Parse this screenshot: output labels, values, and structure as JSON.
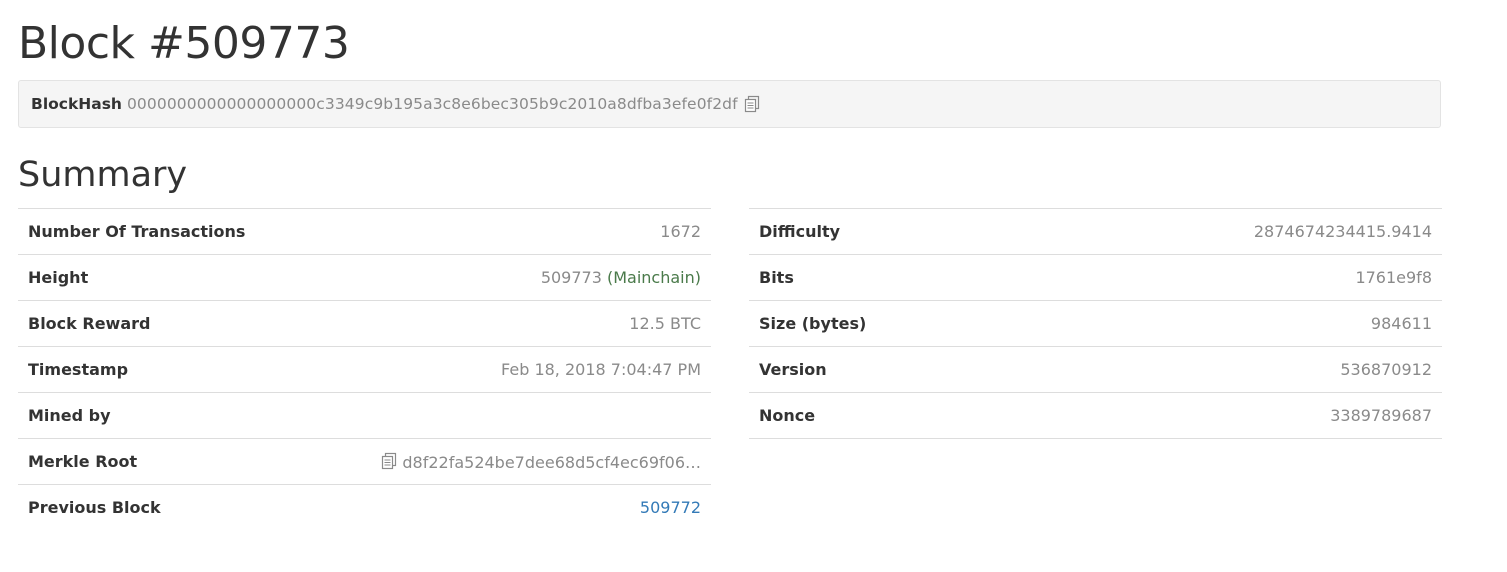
{
  "block": {
    "title": "Block #509773",
    "hash_label": "BlockHash",
    "hash_value": "0000000000000000000c3349c9b195a3c8e6bec305b9c2010a8dfba3efe0f2df"
  },
  "summary": {
    "title": "Summary",
    "left_rows": [
      {
        "label": "Number Of Transactions",
        "value": "1672"
      },
      {
        "label": "Height",
        "value": "509773",
        "chain": "(Mainchain)"
      },
      {
        "label": "Block Reward",
        "value": "12.5 BTC"
      },
      {
        "label": "Timestamp",
        "value": "Feb 18, 2018 7:04:47 PM"
      },
      {
        "label": "Mined by",
        "value": ""
      },
      {
        "label": "Merkle Root",
        "value": "d8f22fa524be7dee68d5cf4ec69f06…"
      },
      {
        "label": "Previous Block",
        "value": "509772"
      }
    ],
    "right_rows": [
      {
        "label": "Difficulty",
        "value": "2874674234415.9414"
      },
      {
        "label": "Bits",
        "value": "1761e9f8"
      },
      {
        "label": "Size (bytes)",
        "value": "984611"
      },
      {
        "label": "Version",
        "value": "536870912"
      },
      {
        "label": "Nonce",
        "value": "3389789687"
      }
    ]
  },
  "icons": {
    "copy": "copy-icon"
  },
  "colors": {
    "text": "#333333",
    "muted": "#8a8a8a",
    "link": "#337ab7",
    "mainchain": "#4a7a4a",
    "well_bg": "#f5f5f5",
    "divider": "#dddddd"
  }
}
